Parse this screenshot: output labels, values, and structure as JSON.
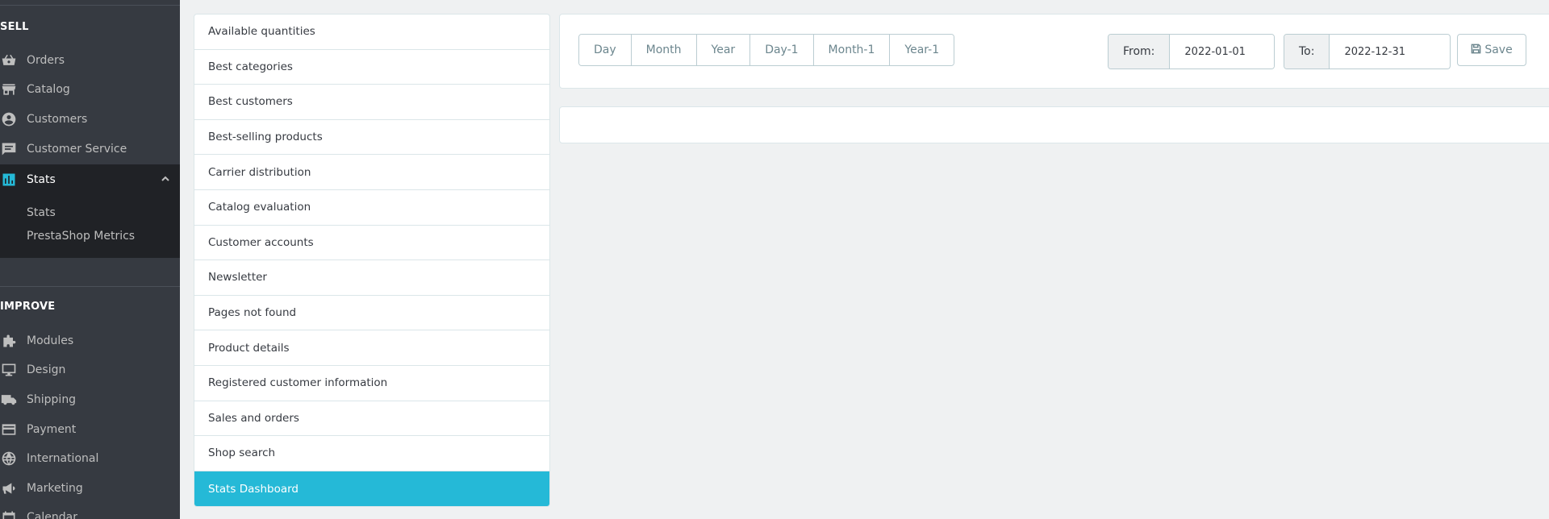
{
  "sidebar": {
    "sections": {
      "sell": "SELL",
      "improve": "IMPROVE"
    },
    "items": [
      {
        "label": "Orders",
        "icon": "basket-icon"
      },
      {
        "label": "Catalog",
        "icon": "store-icon"
      },
      {
        "label": "Customers",
        "icon": "account-circle-icon"
      },
      {
        "label": "Customer Service",
        "icon": "chat-icon"
      },
      {
        "label": "Stats",
        "icon": "bar-chart-icon",
        "active": true
      }
    ],
    "stats_sub": [
      "Stats",
      "PrestaShop Metrics"
    ],
    "improve_items": [
      {
        "label": "Modules",
        "icon": "puzzle-icon"
      },
      {
        "label": "Design",
        "icon": "desktop-icon"
      },
      {
        "label": "Shipping",
        "icon": "truck-icon"
      },
      {
        "label": "Payment",
        "icon": "credit-card-icon"
      },
      {
        "label": "International",
        "icon": "globe-icon"
      },
      {
        "label": "Marketing",
        "icon": "megaphone-icon"
      },
      {
        "label": "Calendar",
        "icon": "calendar-icon"
      }
    ]
  },
  "reports": [
    "Available quantities",
    "Best categories",
    "Best customers",
    "Best-selling products",
    "Carrier distribution",
    "Catalog evaluation",
    "Customer accounts",
    "Newsletter",
    "Pages not found",
    "Product details",
    "Registered customer information",
    "Sales and orders",
    "Shop search",
    "Stats Dashboard"
  ],
  "reports_active_index": 13,
  "calendar": {
    "periods": [
      "Day",
      "Month",
      "Year",
      "Day-1",
      "Month-1",
      "Year-1"
    ],
    "from_label": "From:",
    "from_value": "2022-01-01",
    "to_label": "To:",
    "to_value": "2022-12-31",
    "save_label": "Save"
  },
  "colors": {
    "sidebar_bg": "#363a41",
    "accent": "#25b9d7",
    "active_bg": "#202226"
  }
}
